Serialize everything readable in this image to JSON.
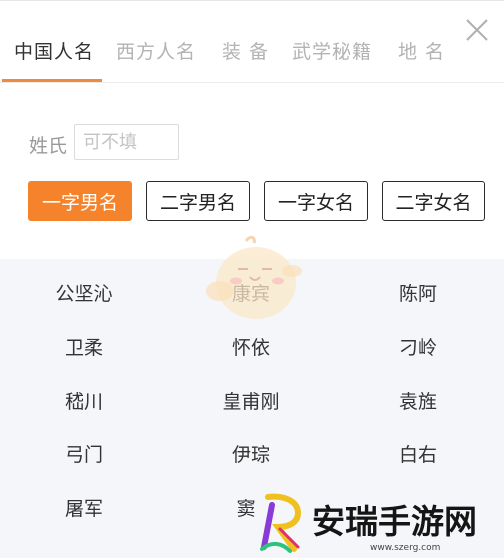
{
  "tabs": [
    {
      "label": "中国人名",
      "active": true
    },
    {
      "label": "西方人名",
      "active": false
    },
    {
      "label": "装 备",
      "active": false
    },
    {
      "label": "武学秘籍",
      "active": false
    },
    {
      "label": "地 名",
      "active": false
    }
  ],
  "surname": {
    "label": "姓氏",
    "placeholder": "可不填",
    "value": ""
  },
  "name_types": [
    {
      "label": "一字男名",
      "active": true
    },
    {
      "label": "二字男名",
      "active": false
    },
    {
      "label": "一字女名",
      "active": false
    },
    {
      "label": "二字女名",
      "active": false
    }
  ],
  "names": [
    [
      "公坚沁",
      "康宾",
      "陈阿"
    ],
    [
      "卫柔",
      "怀依",
      "刁岭"
    ],
    [
      "嵇川",
      "皇甫刚",
      "袁旌"
    ],
    [
      "弓门",
      "伊琮",
      "白右"
    ],
    [
      "屠军",
      "窦",
      ""
    ]
  ],
  "watermark": {
    "text": "安瑞手游网",
    "url": "www.szerg.com"
  },
  "colors": {
    "accent": "#f5832b",
    "underline": "#f08a3c",
    "names_bg": "#f4f6fa"
  },
  "icons": {
    "close": "close-icon",
    "mascot": "mascot-chick-icon",
    "watermark_logo": "watermark-logo-icon"
  }
}
